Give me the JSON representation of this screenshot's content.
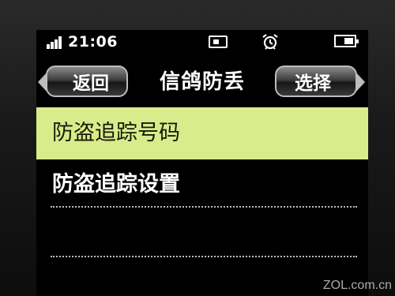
{
  "status_bar": {
    "time": "21:06",
    "icons": [
      "signal-icon",
      "sim-card-icon",
      "alarm-icon",
      "battery-icon"
    ]
  },
  "title_bar": {
    "left_softkey": "返回",
    "title": "信鸽防丢",
    "right_softkey": "选择"
  },
  "menu": {
    "items": [
      {
        "label": "防盗追踪号码",
        "selected": true
      },
      {
        "label": "防盗追踪设置",
        "selected": false
      }
    ]
  },
  "watermark": "ZOL.com.cn",
  "colors": {
    "selection_highlight": "#d9ec8b",
    "screen_background": "#000000",
    "text": "#ffffff"
  }
}
